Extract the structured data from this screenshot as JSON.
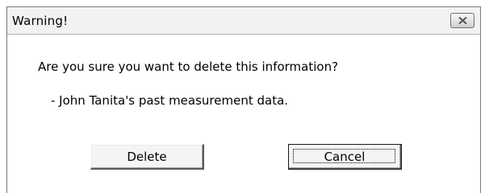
{
  "dialog": {
    "title": "Warning!",
    "close_icon": "close-x-icon",
    "message": "Are you sure you want to delete this information?",
    "detail": "- John Tanita's past measurement data.",
    "buttons": {
      "delete_label": "Delete",
      "cancel_label": "Cancel"
    },
    "default_button": "Cancel"
  }
}
